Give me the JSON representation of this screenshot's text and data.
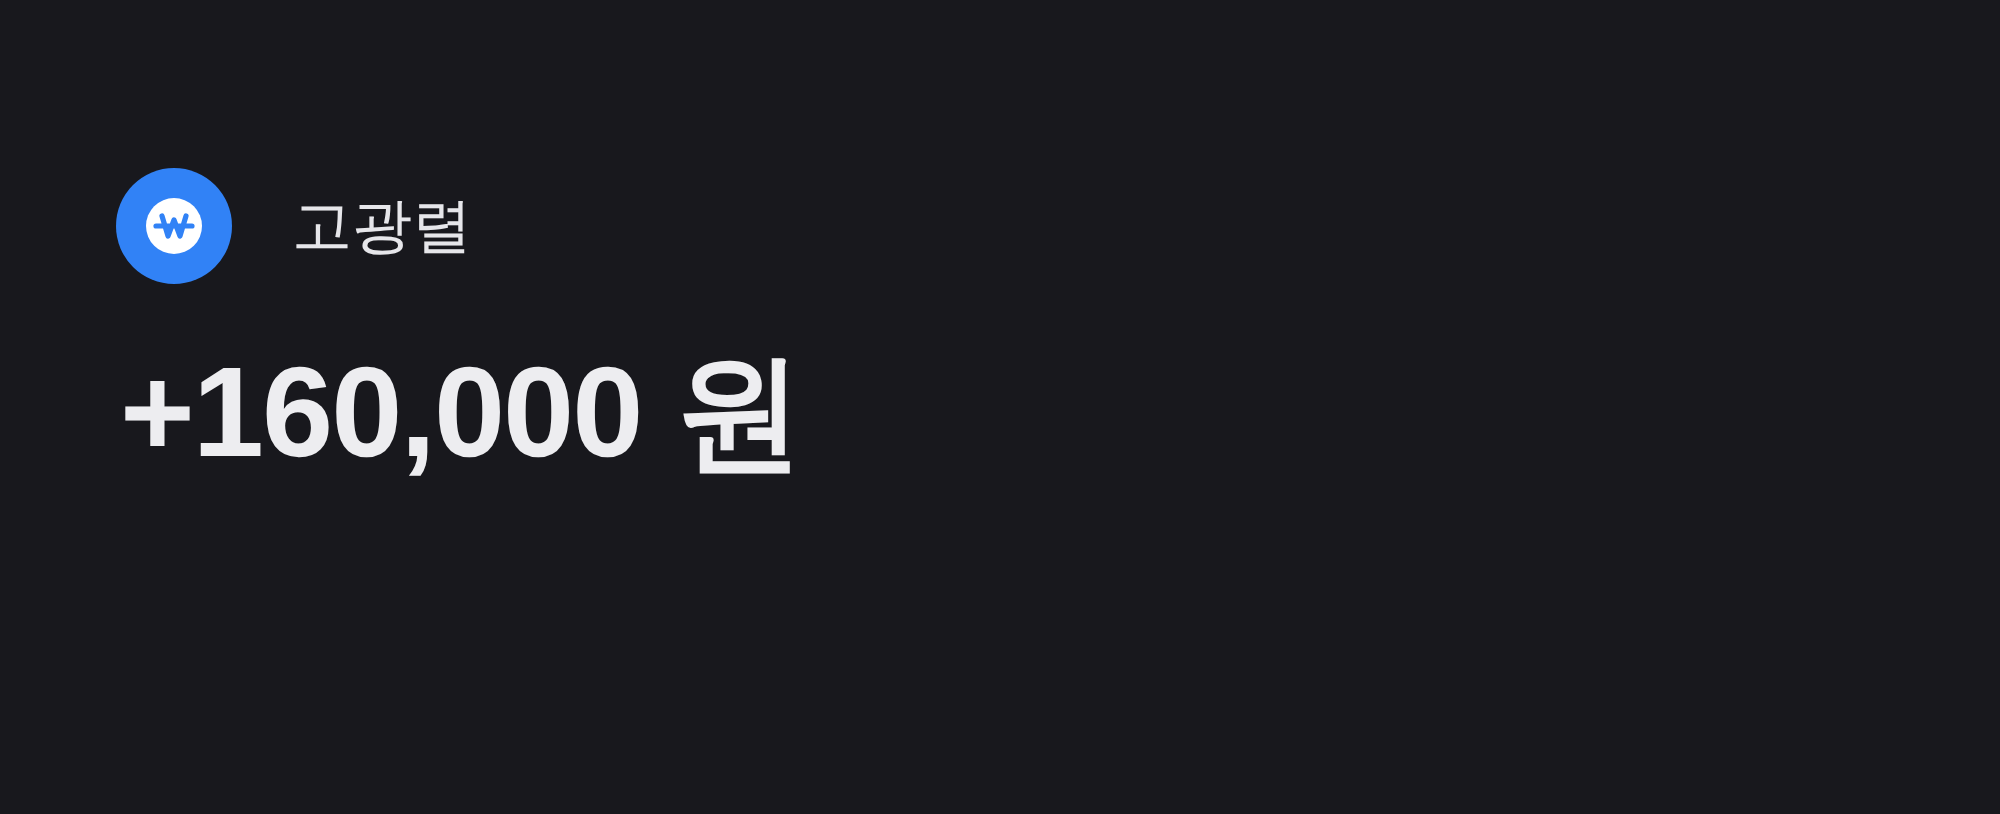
{
  "sender": {
    "name": "고광렬"
  },
  "amount": "+160,000 원"
}
